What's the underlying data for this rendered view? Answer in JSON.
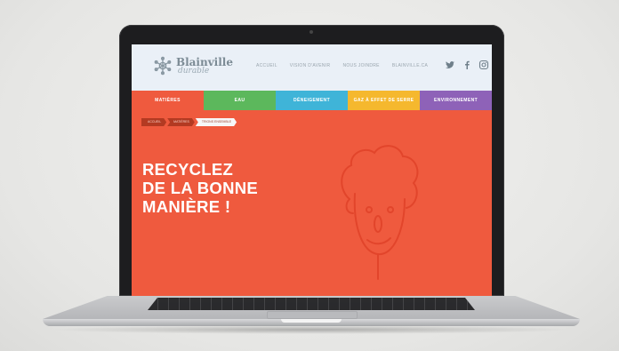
{
  "header": {
    "logo_title": "Blainville",
    "logo_subtitle": "durable",
    "nav": [
      "ACCUEIL",
      "VISION D'AVENIR",
      "NOUS JOINDRE",
      "BLAINVILLE.CA"
    ],
    "social_icons": [
      "twitter-icon",
      "facebook-icon",
      "instagram-icon"
    ]
  },
  "categories": [
    {
      "label": "MATIÈRES",
      "color": "#ef5a3e"
    },
    {
      "label": "EAU",
      "color": "#5cb85c"
    },
    {
      "label": "DÉNEIGEMENT",
      "color": "#3fb4d8"
    },
    {
      "label": "GAZ À EFFET DE SERRE",
      "color": "#f5b82e"
    },
    {
      "label": "ENVIRONNEMENT",
      "color": "#8e62b8"
    }
  ],
  "breadcrumb": [
    "ACCUEIL",
    "MATIÈRES",
    "TRIONS ENSEMBLE"
  ],
  "hero": {
    "line1": "RECYCLEZ",
    "line2": "DE LA BONNE",
    "line3": "MANIÈRE !",
    "background": "#ef5a3e"
  }
}
